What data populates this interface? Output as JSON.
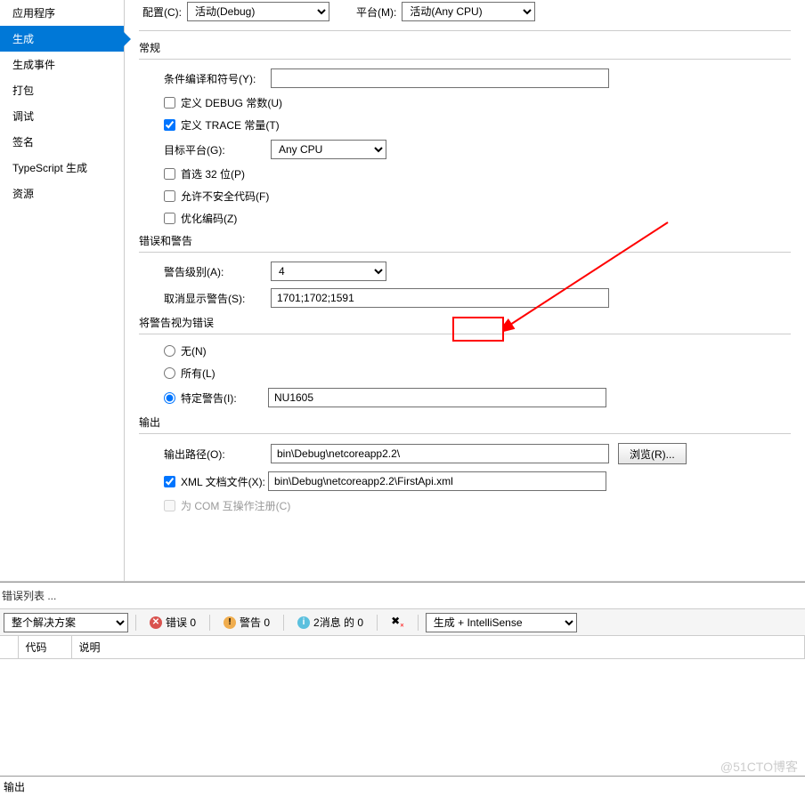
{
  "sidebar": {
    "items": [
      {
        "label": "应用程序"
      },
      {
        "label": "生成"
      },
      {
        "label": "生成事件"
      },
      {
        "label": "打包"
      },
      {
        "label": "调试"
      },
      {
        "label": "签名"
      },
      {
        "label": "TypeScript 生成"
      },
      {
        "label": "资源"
      }
    ]
  },
  "topbar": {
    "config_label": "配置(C):",
    "config_value": "活动(Debug)",
    "platform_label": "平台(M):",
    "platform_value": "活动(Any CPU)"
  },
  "sections": {
    "general": "常规",
    "errors_warnings": "错误和警告",
    "treat_as_errors": "将警告视为错误",
    "output": "输出"
  },
  "labels": {
    "conditional_symbols": "条件编译和符号(Y):",
    "define_debug": "定义 DEBUG 常数(U)",
    "define_trace": "定义 TRACE 常量(T)",
    "target_platform": "目标平台(G):",
    "target_platform_value": "Any CPU",
    "prefer_32": "首选 32 位(P)",
    "allow_unsafe": "允许不安全代码(F)",
    "optimize": "优化编码(Z)",
    "warning_level": "警告级别(A):",
    "warning_level_value": "4",
    "suppress_warnings": "取消显示警告(S):",
    "suppress_value": "1701;1702;1591",
    "none": "无(N)",
    "all": "所有(L)",
    "specific": "特定警告(I):",
    "specific_value": "NU1605",
    "output_path": "输出路径(O):",
    "output_path_value": "bin\\Debug\\netcoreapp2.2\\",
    "browse": "浏览(R)...",
    "xml_doc": "XML 文档文件(X):",
    "xml_doc_value": "bin\\Debug\\netcoreapp2.2\\FirstApi.xml",
    "com_register": "为 COM 互操作注册(C)"
  },
  "error_list": {
    "title": "错误列表 ...",
    "scope": "整个解决方案",
    "errors": "错误 0",
    "warnings": "警告 0",
    "messages": "2消息 的 0",
    "mode": "生成 + IntelliSense",
    "col_code": "代码",
    "col_desc": "说明"
  },
  "output_title": "输出",
  "watermark": "@51CTO博客"
}
